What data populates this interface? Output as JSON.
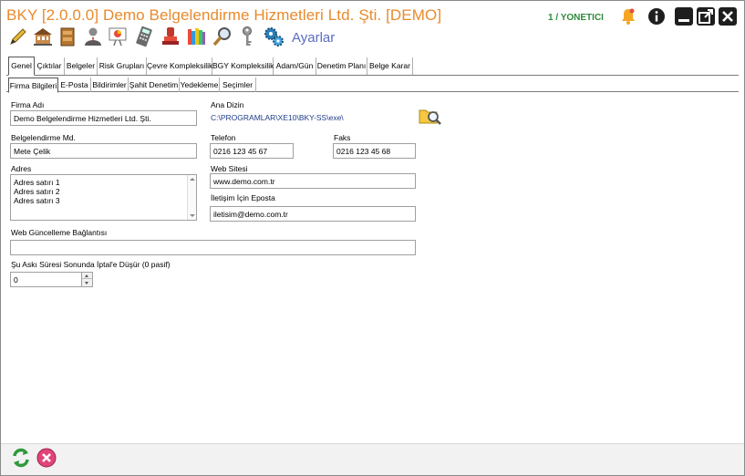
{
  "window": {
    "title": "BKY [2.0.0.0] Demo Belgelendirme Hizmetleri Ltd. Şti. [DEMO]",
    "user": "1 / YONETICI",
    "accent_color": "#e98a2c",
    "user_color": "#2e8a3a"
  },
  "toolbar": {
    "icons": [
      "pen-icon",
      "building-icon",
      "cabinet-icon",
      "person-icon",
      "presentation-icon",
      "calculator-icon",
      "stamp-icon",
      "books-icon",
      "magnifier-icon",
      "key-icon",
      "gears-icon"
    ],
    "settings_label": "Ayarlar"
  },
  "tabs": {
    "main": [
      "Genel",
      "Çıktılar",
      "Belgeler",
      "Risk Grupları",
      "Çevre Kompleksilik",
      "BGY Kompleksilik",
      "Adam/Gün",
      "Denetim Planı",
      "Belge Karar"
    ],
    "sub": [
      "Firma Bilgileri",
      "E-Posta",
      "Bildirimler",
      "Şahit Denetim",
      "Yedekleme",
      "Seçimler"
    ],
    "active_main": "Genel",
    "active_sub": "Firma Bilgileri"
  },
  "form": {
    "firma_adi_label": "Firma Adı",
    "firma_adi_value": "Demo Belgelendirme Hizmetleri Ltd. Şti.",
    "ana_dizin_label": "Ana Dizin",
    "ana_dizin_value": "C:\\PROGRAMLAR\\XE10\\BKY-SS\\exe\\",
    "belgelendirme_md_label": "Belgelendirme Md.",
    "belgelendirme_md_value": "Mete Çelik",
    "telefon_label": "Telefon",
    "telefon_value": "0216 123 45 67",
    "faks_label": "Faks",
    "faks_value": "0216 123 45 68",
    "adres_label": "Adres",
    "adres_lines": [
      "Adres satırı 1",
      "Adres satırı 2",
      "Adres satırı 3"
    ],
    "web_sitesi_label": "Web Sitesi",
    "web_sitesi_value": "www.demo.com.tr",
    "iletisim_eposta_label": "İletişim İçin Eposta",
    "iletisim_eposta_value": "iletisim@demo.com.tr",
    "web_guncelleme_label": "Web Güncelleme Bağlantısı",
    "web_guncelleme_value": "",
    "aski_label": "Şu Askı Süresi Sonunda İptal'e Düşür (0 pasif)",
    "aski_value": "0"
  },
  "footer": {
    "buttons": [
      "refresh-icon",
      "cancel-icon"
    ]
  }
}
